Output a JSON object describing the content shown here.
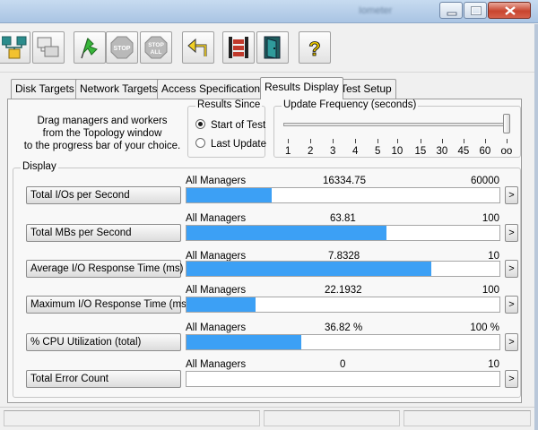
{
  "colors": {
    "bar_fill": "#3ca0f5",
    "title_bar": "#b9d1ea",
    "close_button": "#c8452f"
  },
  "window": {
    "title": "Iometer",
    "buttons": [
      "minimize-icon",
      "maximize-icon",
      "close-icon"
    ]
  },
  "toolbar": [
    {
      "icon": "network-topology-icon"
    },
    {
      "icon": "copy-worker-icon"
    },
    {
      "icon": "start-green-flag-icon"
    },
    {
      "icon": "stop-sign-icon",
      "label": "STOP"
    },
    {
      "icon": "stop-all-sign-icon",
      "label_top": "STOP",
      "label_bottom": "ALL"
    },
    {
      "icon": "reset-arrow-icon"
    },
    {
      "icon": "workers-icon"
    },
    {
      "icon": "exit-door-icon"
    },
    {
      "icon": "help-question-icon",
      "label": "?"
    }
  ],
  "tabs": [
    {
      "label": "Disk Targets",
      "active": false
    },
    {
      "label": "Network Targets",
      "active": false
    },
    {
      "label": "Access Specifications",
      "active": false
    },
    {
      "label": "Results Display",
      "active": true
    },
    {
      "label": "Test Setup",
      "active": false
    }
  ],
  "instructions": {
    "line1": "Drag managers and workers",
    "line2": "from the Topology window",
    "line3": "to the progress bar of your choice."
  },
  "results_since": {
    "title": "Results Since",
    "options": [
      {
        "label": "Start of Test",
        "selected": true
      },
      {
        "label": "Last Update",
        "selected": false
      }
    ]
  },
  "update_frequency": {
    "title": "Update Frequency (seconds)",
    "ticks": [
      "1",
      "2",
      "3",
      "4",
      "5",
      "10",
      "15",
      "30",
      "45",
      "60",
      "oo"
    ],
    "selected": "oo"
  },
  "display": {
    "title": "Display",
    "rows": [
      {
        "button": "Total I/Os per Second",
        "manager": "All Managers",
        "value": "16334.75",
        "max": "60000",
        "fill": 0.272,
        "arrow": ">"
      },
      {
        "button": "Total MBs per Second",
        "manager": "All Managers",
        "value": "63.81",
        "max": "100",
        "fill": 0.638,
        "arrow": ">"
      },
      {
        "button": "Average I/O Response Time (ms)",
        "manager": "All Managers",
        "value": "7.8328",
        "max": "10",
        "fill": 0.783,
        "arrow": ">"
      },
      {
        "button": "Maximum I/O Response Time (ms)",
        "manager": "All Managers",
        "value": "22.1932",
        "max": "100",
        "fill": 0.222,
        "arrow": ">"
      },
      {
        "button": "% CPU Utilization (total)",
        "manager": "All Managers",
        "value": "36.82 %",
        "max": "100 %",
        "fill": 0.368,
        "arrow": ">"
      },
      {
        "button": "Total Error Count",
        "manager": "All Managers",
        "value": "0",
        "max": "10",
        "fill": 0,
        "arrow": ">"
      }
    ]
  }
}
